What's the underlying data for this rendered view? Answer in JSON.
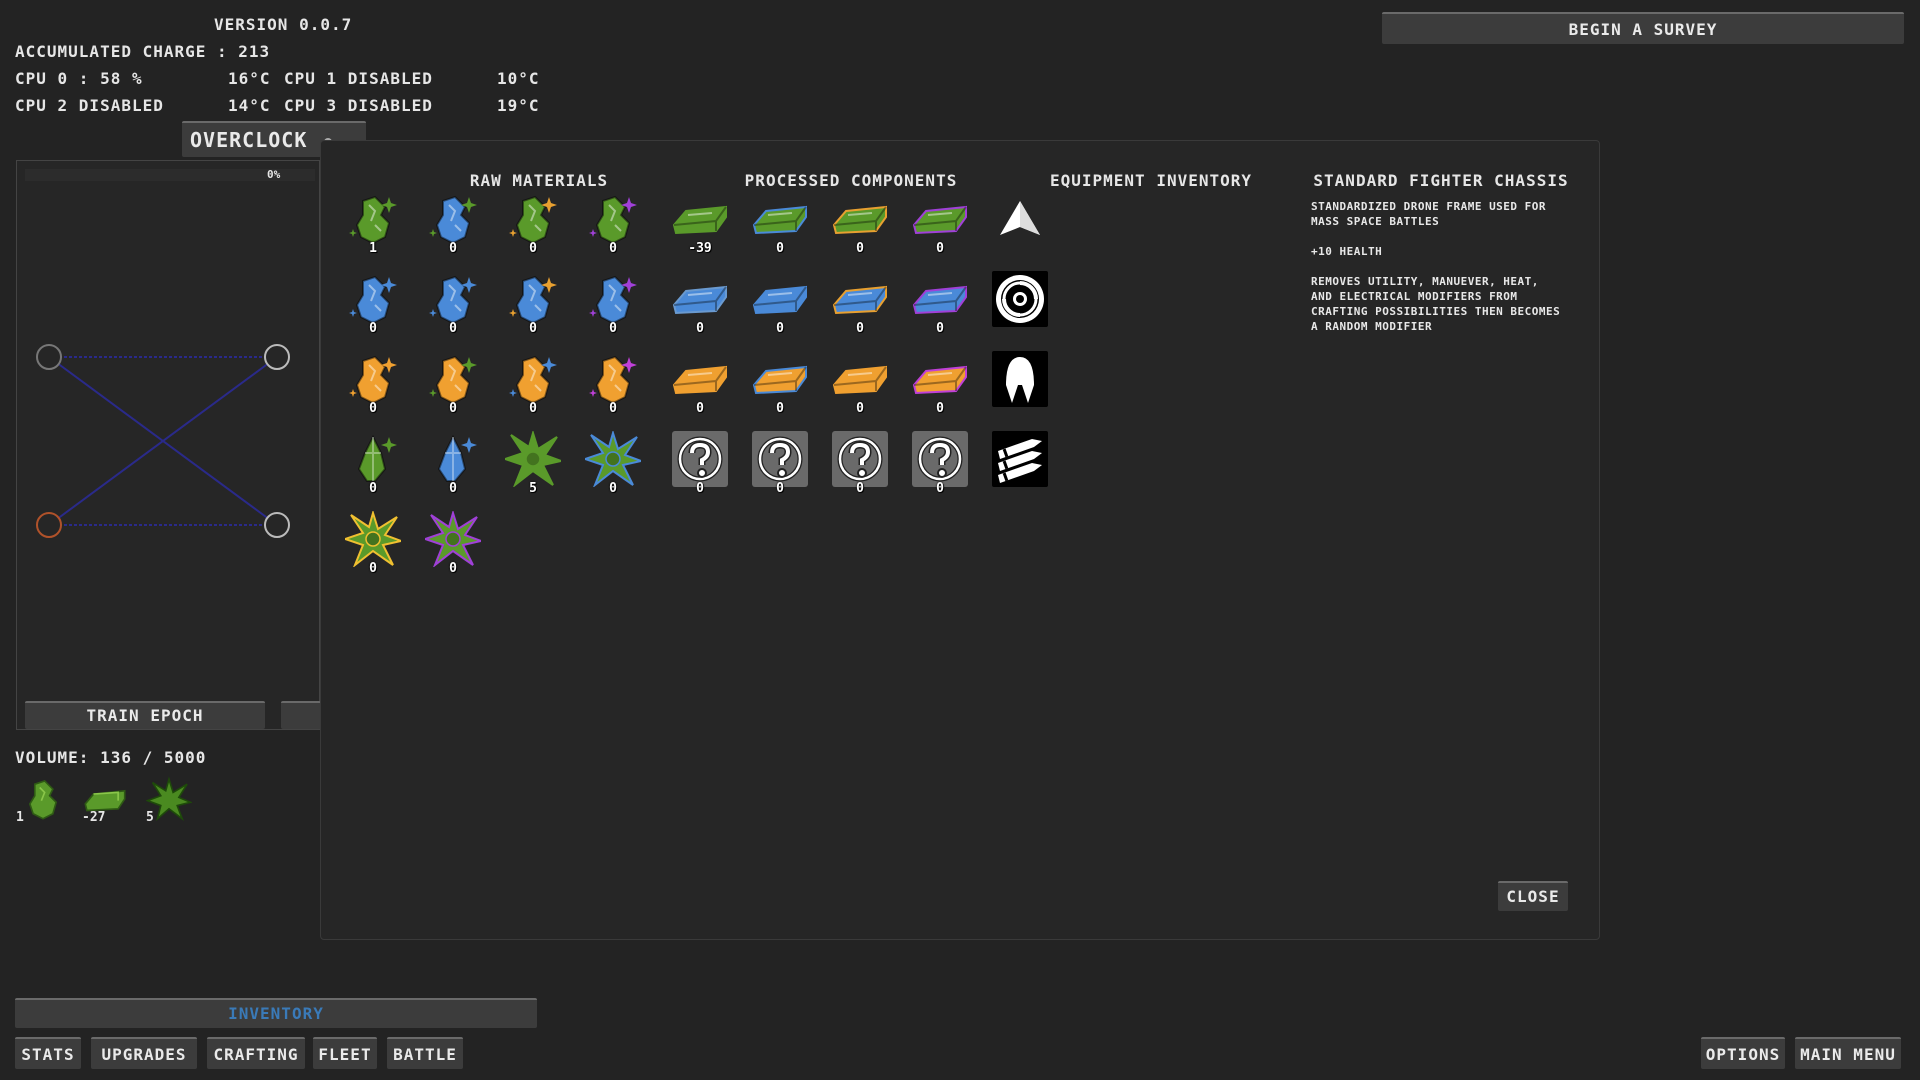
{
  "version": "VERSION 0.0.7",
  "accumulated_charge": "ACCUMULATED CHARGE : 213",
  "cpus": [
    {
      "label": "CPU 0 : 58 %",
      "temp": "16°C"
    },
    {
      "label": "CPU 1 DISABLED",
      "temp": "10°C"
    },
    {
      "label": "CPU 2 DISABLED",
      "temp": "14°C"
    },
    {
      "label": "CPU 3 DISABLED",
      "temp": "19°C"
    }
  ],
  "overclock_label": "OVERCLOCK",
  "survey_button": "BEGIN A SURVEY",
  "sim": {
    "percent": "0%",
    "train_button": "TRAIN EPOCH"
  },
  "volume": "VOLUME: 136 / 5000",
  "volume_items": [
    {
      "icon": "green-crystal-icon",
      "count": "1"
    },
    {
      "icon": "green-ingot-icon",
      "count": "-27"
    },
    {
      "icon": "green-star-icon",
      "count": "5"
    }
  ],
  "inventory": {
    "raw_title": "RAW MATERIALS",
    "processed_title": "PROCESSED COMPONENTS",
    "equipment_title": "EQUIPMENT INVENTORY",
    "raw": [
      [
        {
          "c": "#5a9a2a",
          "a": "#5a9a2a",
          "n": "1"
        },
        {
          "c": "#4a8ad8",
          "a": "#5a9a2a",
          "n": "0"
        },
        {
          "c": "#5a9a2a",
          "a": "#e8a030",
          "n": "0"
        },
        {
          "c": "#5a9a2a",
          "a": "#a040d8",
          "n": "0"
        }
      ],
      [
        {
          "c": "#4a8ad8",
          "a": "#4a8ad8",
          "n": "0"
        },
        {
          "c": "#4a8ad8",
          "a": "#4a8ad8",
          "n": "0"
        },
        {
          "c": "#4a8ad8",
          "a": "#e8a030",
          "n": "0"
        },
        {
          "c": "#4a8ad8",
          "a": "#a040d8",
          "n": "0"
        }
      ],
      [
        {
          "c": "#f0a030",
          "a": "#f0a030",
          "n": "0"
        },
        {
          "c": "#f0a030",
          "a": "#5a9a2a",
          "n": "0"
        },
        {
          "c": "#f0a030",
          "a": "#4a8ad8",
          "n": "0"
        },
        {
          "c": "#f0a030",
          "a": "#c040d8",
          "n": "0"
        }
      ],
      [
        {
          "c": "#5a9a2a",
          "a": "#5a9a2a",
          "n": "0",
          "shape": "shard"
        },
        {
          "c": "#4a8ad8",
          "a": "#4a8ad8",
          "n": "0",
          "shape": "shard"
        },
        {
          "c": "#5a9a2a",
          "a": "#5a9a2a",
          "n": "5",
          "shape": "burst"
        },
        {
          "c": "#5a9a2a",
          "a": "#4a8ad8",
          "n": "0",
          "shape": "burst"
        }
      ],
      [
        {
          "c": "#5a9a2a",
          "a": "#f0c030",
          "n": "0",
          "shape": "burst"
        },
        {
          "c": "#5a9a2a",
          "a": "#a040d8",
          "n": "0",
          "shape": "burst"
        }
      ]
    ],
    "processed": [
      [
        {
          "c": "#5a9a2a",
          "a": "#5a9a2a",
          "n": "-39"
        },
        {
          "c": "#5a9a2a",
          "a": "#4a8ad8",
          "n": "0"
        },
        {
          "c": "#5a9a2a",
          "a": "#e8a030",
          "n": "0"
        },
        {
          "c": "#5a9a2a",
          "a": "#a040d8",
          "n": "0"
        }
      ],
      [
        {
          "c": "#4a8ad8",
          "a": "#6a9ad0",
          "n": "0"
        },
        {
          "c": "#4a8ad8",
          "a": "#4a8ad8",
          "n": "0"
        },
        {
          "c": "#4a8ad8",
          "a": "#e8a030",
          "n": "0"
        },
        {
          "c": "#4a8ad8",
          "a": "#a040d8",
          "n": "0"
        }
      ],
      [
        {
          "c": "#f0a030",
          "a": "#f0a030",
          "n": "0"
        },
        {
          "c": "#f0a030",
          "a": "#4a8ad8",
          "n": "0"
        },
        {
          "c": "#f0a030",
          "a": "#f0a030",
          "n": "0"
        },
        {
          "c": "#f0a030",
          "a": "#c040d8",
          "n": "0"
        }
      ],
      [
        {
          "unknown": true,
          "n": "0"
        },
        {
          "unknown": true,
          "n": "0"
        },
        {
          "unknown": true,
          "n": "0"
        },
        {
          "unknown": true,
          "n": "0"
        }
      ]
    ],
    "equipment": [
      "arrowhead-ship-icon",
      "spiral-vortex-icon",
      "drone-pod-icon",
      "missile-bundle-icon"
    ]
  },
  "detail": {
    "title": "STANDARD FIGHTER CHASSIS",
    "p1": "STANDARDIZED DRONE FRAME USED FOR MASS SPACE BATTLES",
    "p2": "+10 HEALTH",
    "p3": "REMOVES UTILITY, MANUEVER, HEAT, AND ELECTRICAL MODIFIERS FROM CRAFTING POSSIBILITIES THEN BECOMES A RANDOM MODIFIER"
  },
  "close_button": "CLOSE",
  "inventory_tab": "INVENTORY",
  "nav": [
    "STATS",
    "UPGRADES",
    "CRAFTING",
    "FLEET",
    "BATTLE"
  ],
  "options_button": "OPTIONS",
  "main_menu_button": "MAIN MENU",
  "colors": {
    "accent_blue": "#3a7ab8",
    "background": "#232323",
    "panel": "#262626"
  }
}
